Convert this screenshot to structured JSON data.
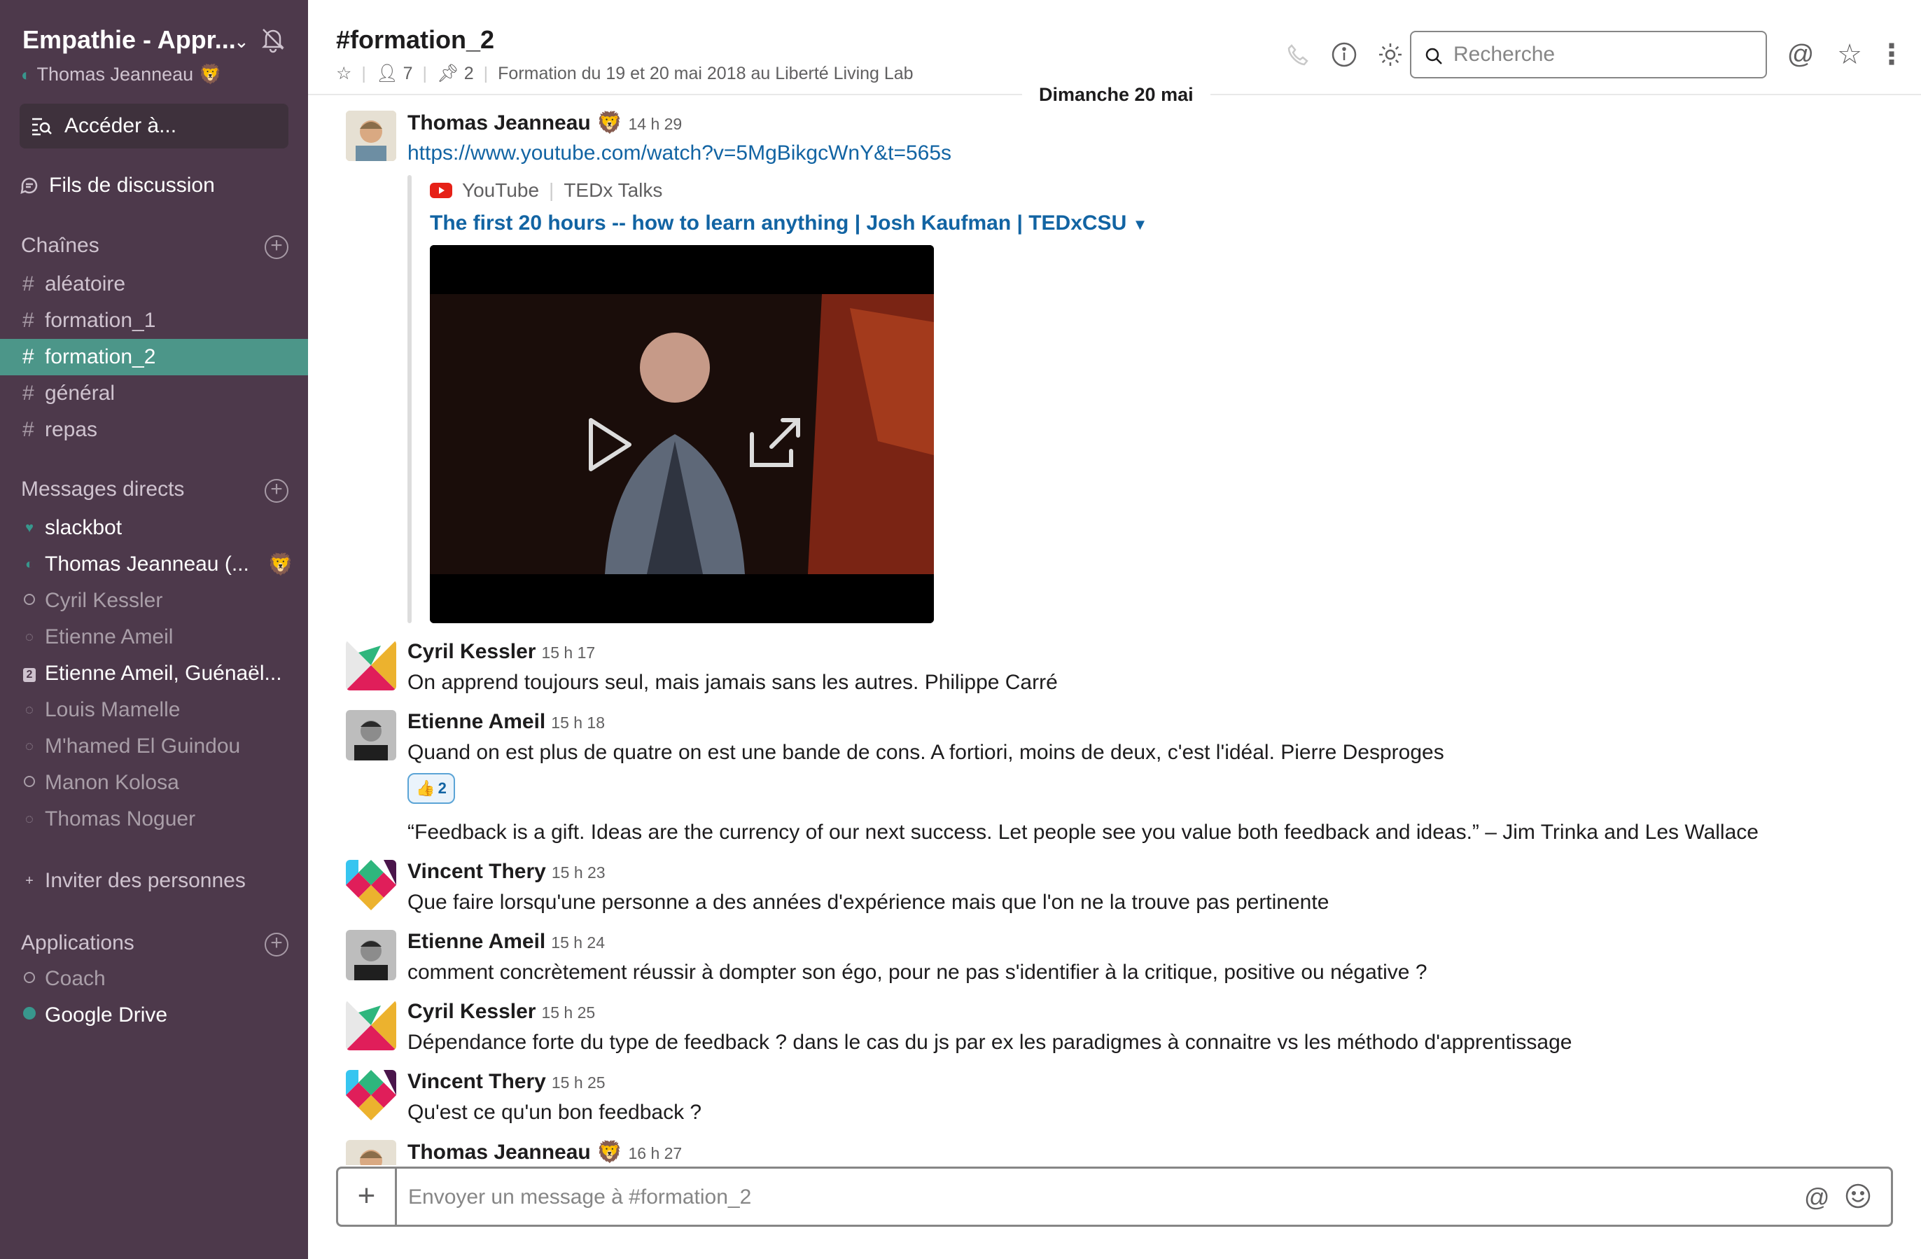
{
  "workspace": {
    "name": "Empathie - Appr...",
    "user": "Thomas Jeanneau"
  },
  "sidebar": {
    "jump_label": "Accéder à...",
    "threads_label": "Fils de discussion",
    "channels_header": "Chaînes",
    "channels": [
      "aléatoire",
      "formation_1",
      "formation_2",
      "général",
      "repas"
    ],
    "active_channel": "formation_2",
    "dm_header": "Messages directs",
    "dms": [
      {
        "name": "slackbot",
        "status": "heart"
      },
      {
        "name": "Thomas Jeanneau  (...",
        "status": "online"
      },
      {
        "name": "Cyril Kessler",
        "status": "away"
      },
      {
        "name": "Etienne Ameil",
        "status": "away"
      },
      {
        "name": "Etienne Ameil, Guénaël...",
        "status": "group",
        "badge": "2"
      },
      {
        "name": "Louis Mamelle",
        "status": "away"
      },
      {
        "name": "M'hamed El Guindou",
        "status": "away"
      },
      {
        "name": "Manon Kolosa",
        "status": "away"
      },
      {
        "name": "Thomas Noguer",
        "status": "away"
      }
    ],
    "invite_label": "Inviter des personnes",
    "apps_header": "Applications",
    "apps": [
      {
        "name": "Coach",
        "status": "away"
      },
      {
        "name": "Google Drive",
        "status": "online"
      }
    ]
  },
  "header": {
    "channel": "#formation_2",
    "members": "7",
    "pins": "2",
    "topic": "Formation du 19 et 20 mai 2018 au Liberté Living Lab",
    "search_placeholder": "Recherche"
  },
  "date_divider": "Dimanche 20 mai",
  "messages": [
    {
      "author": "Thomas Jeanneau",
      "time": "14 h 29",
      "text": "https://www.youtube.com/watch?v=5MgBikgcWnY&t=565s",
      "attachment": {
        "source": "YouTube",
        "channel": "TEDx Talks",
        "title": "The first 20 hours -- how to learn anything | Josh Kaufman | TEDxCSU"
      }
    },
    {
      "author": "Cyril Kessler",
      "time": "15 h 17",
      "text": "On apprend toujours seul, mais jamais sans les autres. Philippe Carré"
    },
    {
      "author": "Etienne Ameil",
      "time": "15 h 18",
      "text": "Quand on est plus de quatre on est une bande de cons. A fortiori, moins de deux, c'est l'idéal. Pierre Desproges",
      "reaction": {
        "emoji": "👍",
        "count": "2"
      },
      "followup": "“Feedback is a gift. Ideas are the currency of our next success. Let people see you value both feedback and ideas.” – Jim Trinka and Les Wallace"
    },
    {
      "author": "Vincent Thery",
      "time": "15 h 23",
      "text": "Que faire lorsqu'une personne a des années d'expérience mais que l'on ne la trouve pas pertinente"
    },
    {
      "author": "Etienne Ameil",
      "time": "15 h 24",
      "text": "comment concrètement réussir à dompter son égo, pour ne pas s'identifier à la critique, positive ou négative ?"
    },
    {
      "author": "Cyril Kessler",
      "time": "15 h 25",
      "text": "Dépendance forte du type de feedback ? dans le cas du js par ex les paradigmes à connaitre vs les méthodo d'apprentissage"
    },
    {
      "author": "Vincent Thery",
      "time": "15 h 25",
      "text": "Qu'est ce qu'un bon feedback ?"
    },
    {
      "author": "Thomas Jeanneau",
      "time": "16 h 27",
      "text": ""
    }
  ],
  "composer": {
    "placeholder": "Envoyer un message à #formation_2"
  }
}
